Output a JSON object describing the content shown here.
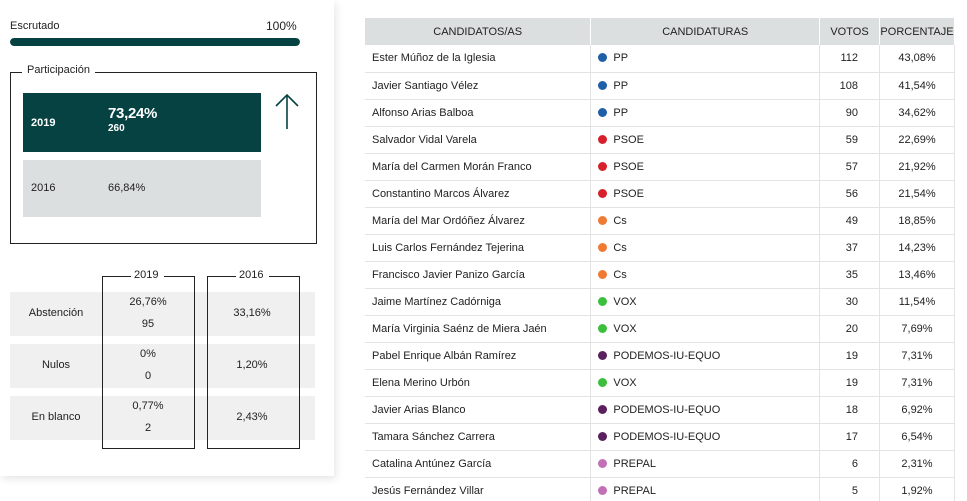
{
  "escrutado": {
    "label": "Escrutado",
    "value": "100%",
    "progress": 1.0
  },
  "participacion": {
    "title": "Participación",
    "y2019": {
      "year": "2019",
      "percent": "73,24%",
      "count": "260"
    },
    "y2016": {
      "year": "2016",
      "percent": "66,84%"
    },
    "trend_icon": "arrow-up-icon"
  },
  "stats": {
    "col_2019": "2019",
    "col_2016": "2016",
    "rows": [
      {
        "label": "Abstención",
        "v2019_pct": "26,76%",
        "v2019_num": "95",
        "v2016": "33,16%"
      },
      {
        "label": "Nulos",
        "v2019_pct": "0%",
        "v2019_num": "0",
        "v2016": "1,20%"
      },
      {
        "label": "En blanco",
        "v2019_pct": "0,77%",
        "v2019_num": "2",
        "v2016": "2,43%"
      }
    ]
  },
  "table": {
    "headers": [
      "CANDIDATOS/AS",
      "CANDIDATURAS",
      "VOTOS",
      "PORCENTAJE"
    ],
    "rows": [
      {
        "name": "Ester Múñoz de la Iglesia",
        "party": "PP",
        "color": "#1f5fa8",
        "votes": "112",
        "pct": "43,08%"
      },
      {
        "name": "Javier Santiago Vélez",
        "party": "PP",
        "color": "#1f5fa8",
        "votes": "108",
        "pct": "41,54%"
      },
      {
        "name": "Alfonso Arias Balboa",
        "party": "PP",
        "color": "#1f5fa8",
        "votes": "90",
        "pct": "34,62%"
      },
      {
        "name": "Salvador Vidal Varela",
        "party": "PSOE",
        "color": "#d6202b",
        "votes": "59",
        "pct": "22,69%"
      },
      {
        "name": "María del Carmen Morán Franco",
        "party": "PSOE",
        "color": "#d6202b",
        "votes": "57",
        "pct": "21,92%"
      },
      {
        "name": "Constantino Marcos Álvarez",
        "party": "PSOE",
        "color": "#d6202b",
        "votes": "56",
        "pct": "21,54%"
      },
      {
        "name": "María del Mar Ordóñez Álvarez",
        "party": "Cs",
        "color": "#f07a34",
        "votes": "49",
        "pct": "18,85%"
      },
      {
        "name": "Luis Carlos Fernández Tejerina",
        "party": "Cs",
        "color": "#f07a34",
        "votes": "37",
        "pct": "14,23%"
      },
      {
        "name": "Francisco Javier Panizo García",
        "party": "Cs",
        "color": "#f07a34",
        "votes": "35",
        "pct": "13,46%"
      },
      {
        "name": "Jaime Martínez Cadórniga",
        "party": "VOX",
        "color": "#3cbf3c",
        "votes": "30",
        "pct": "11,54%"
      },
      {
        "name": "María Virginia Saénz de Miera Jaén",
        "party": "VOX",
        "color": "#3cbf3c",
        "votes": "20",
        "pct": "7,69%"
      },
      {
        "name": "Pabel Enrique Albán Ramírez",
        "party": "PODEMOS-IU-EQUO",
        "color": "#5b1f5e",
        "votes": "19",
        "pct": "7,31%"
      },
      {
        "name": "Elena Merino Urbón",
        "party": "VOX",
        "color": "#3cbf3c",
        "votes": "19",
        "pct": "7,31%"
      },
      {
        "name": "Javier Arias Blanco",
        "party": "PODEMOS-IU-EQUO",
        "color": "#5b1f5e",
        "votes": "18",
        "pct": "6,92%"
      },
      {
        "name": "Tamara Sánchez Carrera",
        "party": "PODEMOS-IU-EQUO",
        "color": "#5b1f5e",
        "votes": "17",
        "pct": "6,54%"
      },
      {
        "name": "Catalina Antúnez García",
        "party": "PREPAL",
        "color": "#c270b6",
        "votes": "6",
        "pct": "2,31%"
      },
      {
        "name": "Jesús Fernández Villar",
        "party": "PREPAL",
        "color": "#c270b6",
        "votes": "5",
        "pct": "1,92%"
      }
    ]
  }
}
